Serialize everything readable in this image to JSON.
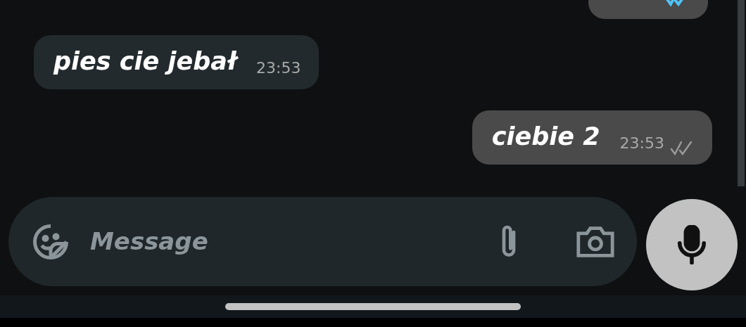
{
  "messages": [
    {
      "kind": "outgoing",
      "read": true
    },
    {
      "kind": "incoming",
      "text": "pies cie jebał",
      "time": "23:53"
    },
    {
      "kind": "outgoing",
      "text": "ciebie 2",
      "time": "23:53",
      "read": false
    }
  ],
  "composer": {
    "placeholder": "Message"
  }
}
